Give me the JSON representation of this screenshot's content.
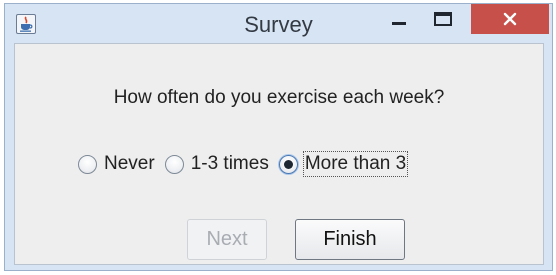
{
  "window": {
    "title": "Survey",
    "app_icon": "java-cup-icon",
    "controls": {
      "minimize_icon": "minimize-icon",
      "maximize_icon": "maximize-icon",
      "close_icon": "close-icon"
    },
    "close_color": "#c7504a"
  },
  "survey": {
    "question": "How often do you exercise each week?",
    "options": [
      {
        "label": "Never",
        "selected": false
      },
      {
        "label": "1-3 times",
        "selected": false
      },
      {
        "label": "More than 3",
        "selected": true
      }
    ]
  },
  "buttons": {
    "next_label": "Next",
    "next_enabled": false,
    "finish_label": "Finish",
    "finish_enabled": true
  }
}
